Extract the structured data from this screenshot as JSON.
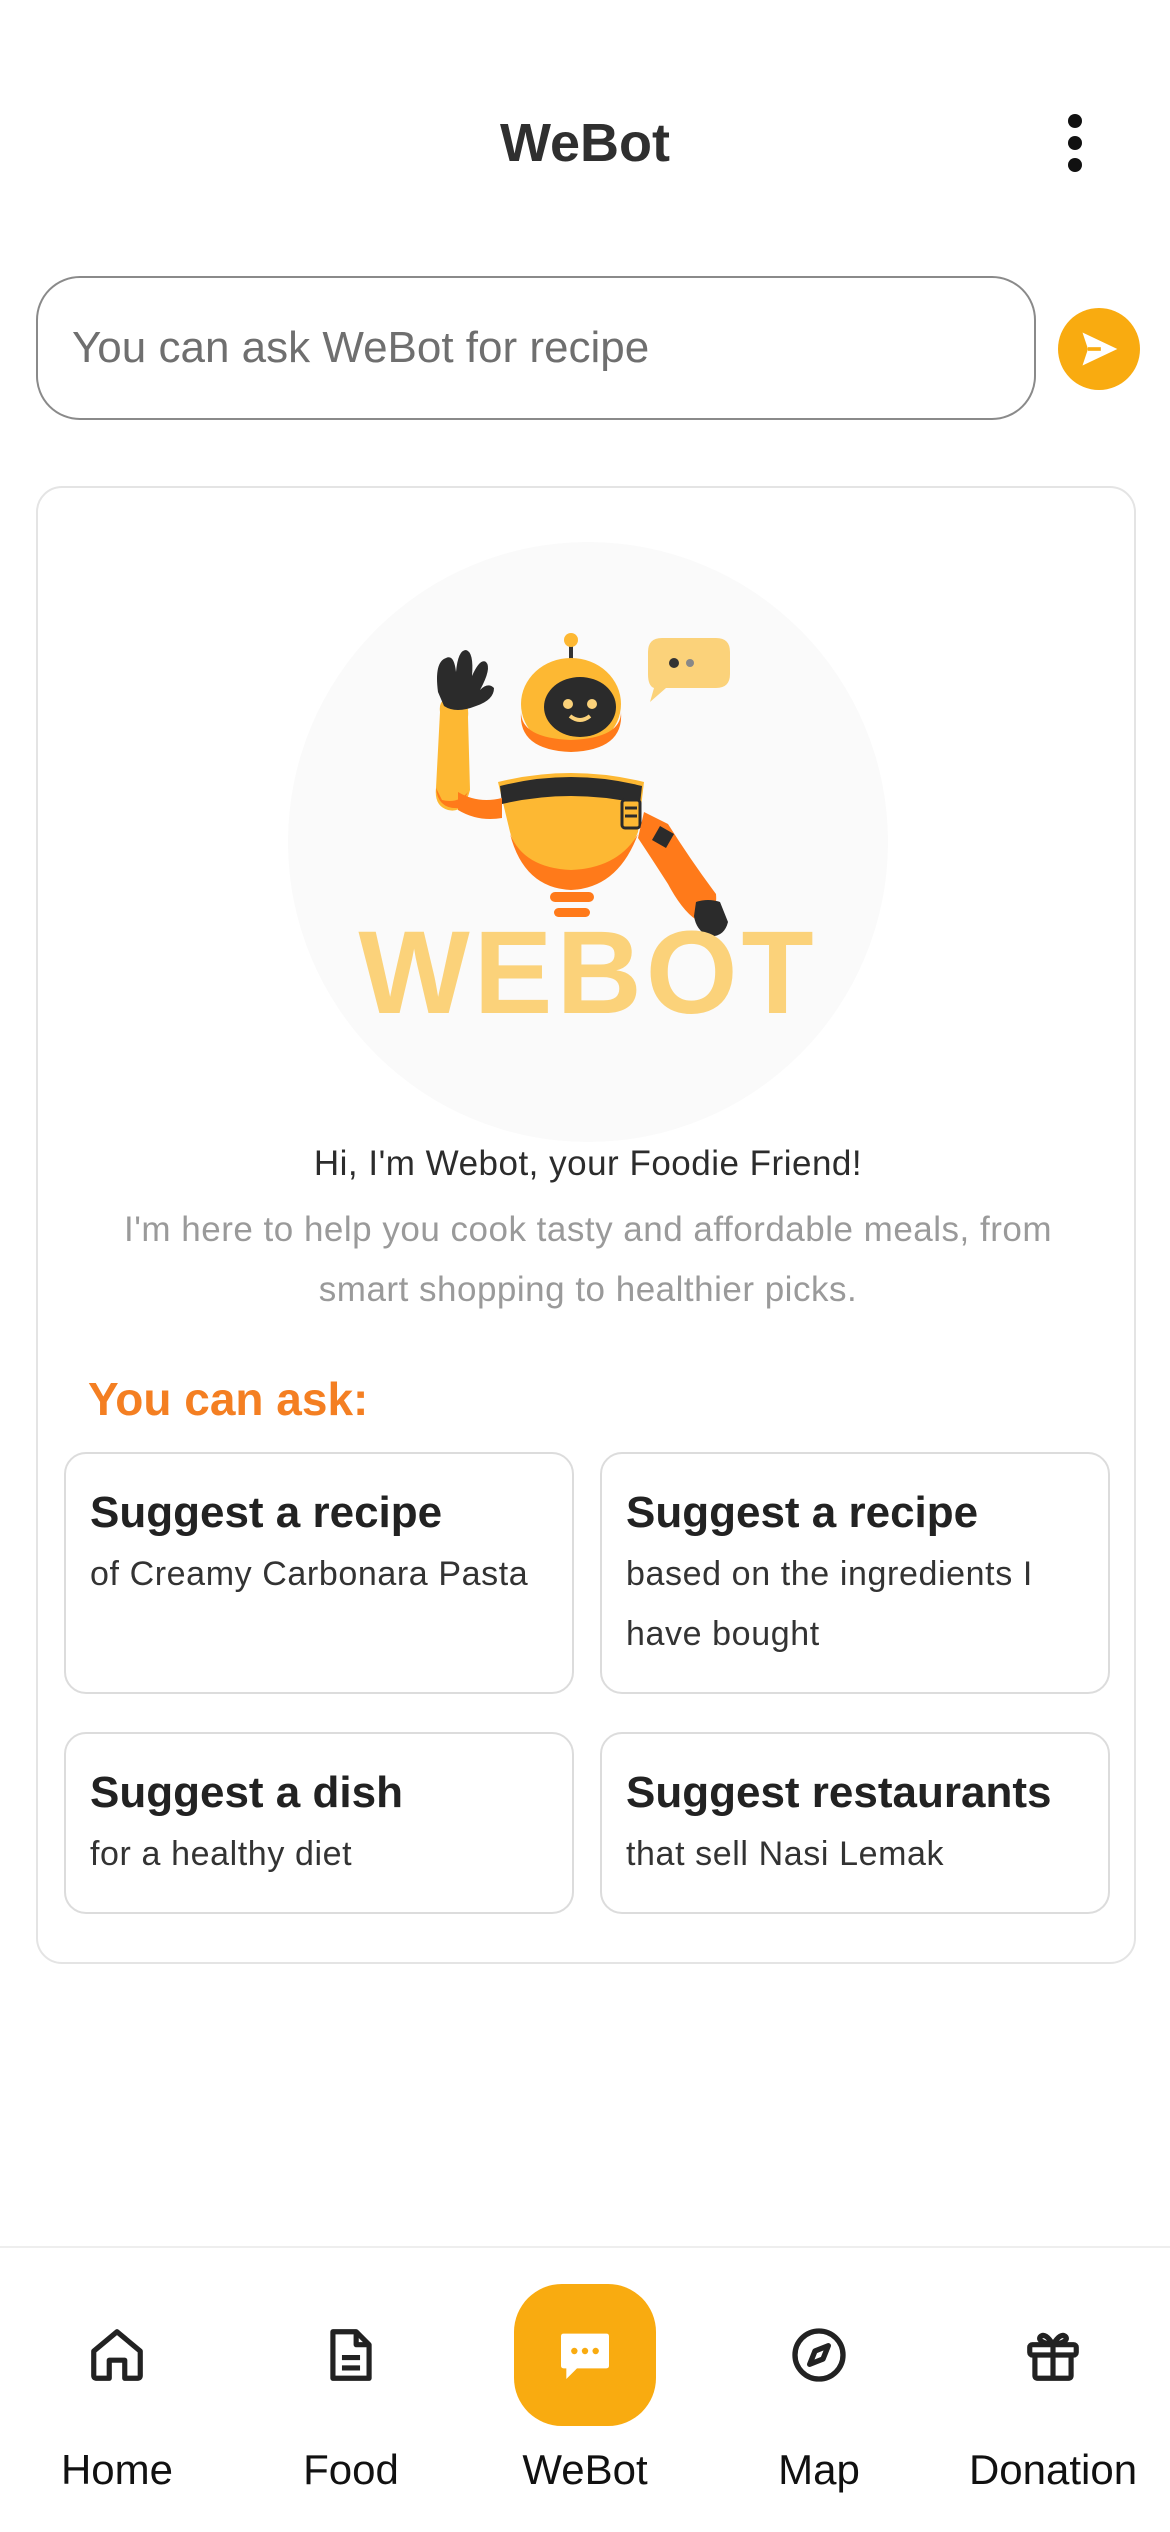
{
  "header": {
    "title": "WeBot",
    "more_icon": "more-vertical-icon"
  },
  "search": {
    "placeholder": "You can ask WeBot for recipe",
    "value": "",
    "send_icon": "send-icon"
  },
  "intro": {
    "logo_text": "WEBOT",
    "greeting": "Hi, I'm Webot, your Foodie Friend!",
    "description": "I'm here to help you cook tasty and affordable meals, from smart shopping to healthier picks."
  },
  "ask": {
    "title": "You can ask:",
    "suggestions": [
      {
        "title": "Suggest a recipe",
        "subtitle": "of Creamy Carbonara Pasta"
      },
      {
        "title": "Suggest a recipe",
        "subtitle": "based on the ingredients I have bought"
      },
      {
        "title": "Suggest a dish",
        "subtitle": "for a healthy diet"
      },
      {
        "title": "Suggest restaurants",
        "subtitle": "that sell Nasi Lemak"
      }
    ]
  },
  "nav": {
    "items": [
      {
        "label": "Home",
        "icon": "home-icon"
      },
      {
        "label": "Food",
        "icon": "document-icon"
      },
      {
        "label": "WeBot",
        "icon": "chat-icon",
        "active": true
      },
      {
        "label": "Map",
        "icon": "compass-icon"
      },
      {
        "label": "Donation",
        "icon": "gift-icon"
      }
    ]
  },
  "colors": {
    "accent": "#f9ab10",
    "ask_title": "#f47f22",
    "logo_text": "#fbd27a",
    "robot_orange": "#ff7a1a",
    "robot_yellow": "#fdb833"
  }
}
